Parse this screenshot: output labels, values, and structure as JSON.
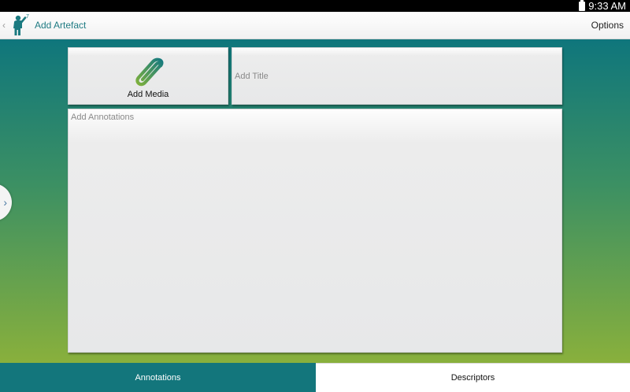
{
  "status_bar": {
    "time": "9:33 AM"
  },
  "action_bar": {
    "back_icon": "chevron-left",
    "logo_icon": "person-app-logo",
    "title": "Add Artefact",
    "options_label": "Options"
  },
  "form": {
    "media": {
      "icon": "paperclip",
      "label": "Add Media"
    },
    "title_placeholder": "Add Title",
    "annotations_placeholder": "Add Annotations"
  },
  "drawer": {
    "icon": "chevron-right"
  },
  "tabs": [
    {
      "label": "Annotations",
      "selected": true
    },
    {
      "label": "Descriptors",
      "selected": false
    }
  ],
  "colors": {
    "accent_teal": "#13767c",
    "title_teal": "#1f7b83",
    "gradient_green": "#89b03c"
  }
}
